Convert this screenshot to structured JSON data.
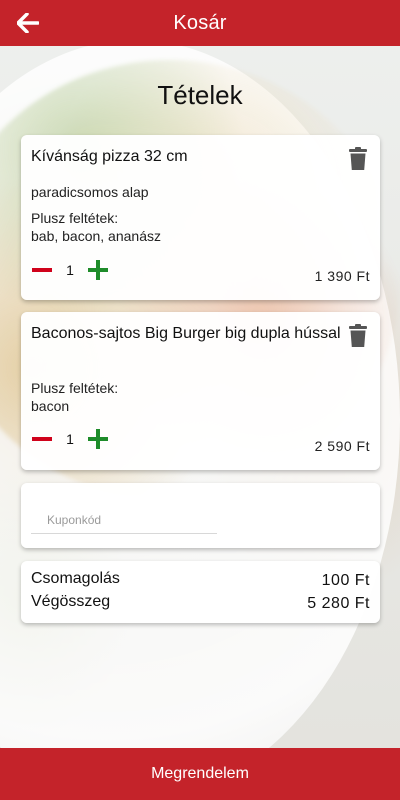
{
  "header": {
    "title": "Kosár",
    "back_icon": "arrow-left-icon"
  },
  "page": {
    "heading": "Tételek"
  },
  "items": [
    {
      "title": "Kívánság pizza 32 cm",
      "base": "paradicsomos alap",
      "extras_label": "Plusz feltétek:",
      "extras": "bab, bacon, ananász",
      "quantity": "1",
      "price": "1 390 Ft"
    },
    {
      "title": "Baconos-sajtos Big Burger big dupla hússal",
      "extras_label": "Plusz feltétek:",
      "extras": "bacon",
      "quantity": "1",
      "price": "2 590 Ft"
    }
  ],
  "coupon": {
    "placeholder": "Kuponkód",
    "value": ""
  },
  "summary": {
    "packaging_label": "Csomagolás",
    "packaging_value": "100 Ft",
    "total_label": "Végösszeg",
    "total_value": "5 280 Ft"
  },
  "footer": {
    "order_label": "Megrendelem"
  },
  "colors": {
    "brand": "#c4232a",
    "minus": "#d0021b",
    "plus": "#1e8c2a",
    "trash": "#555555"
  }
}
